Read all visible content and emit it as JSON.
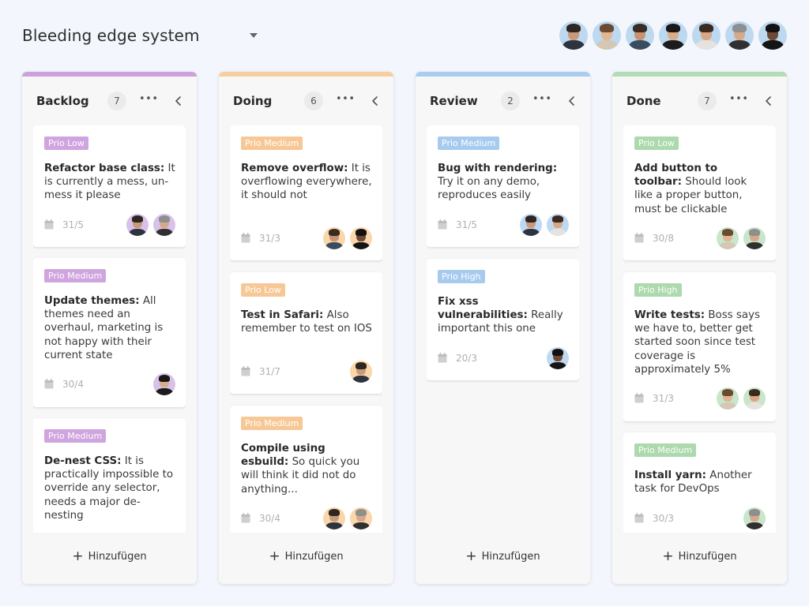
{
  "board": {
    "title": "Bleeding edge system",
    "members": [
      {
        "name": "member-1",
        "bg": "#bcd9f0",
        "skin": "#c99a7a",
        "hair": "#2f2622",
        "shirt": "#2d3440"
      },
      {
        "name": "member-2",
        "bg": "#bcd9f0",
        "skin": "#e3b592",
        "hair": "#6b4a31",
        "shirt": "#d4c7b5"
      },
      {
        "name": "member-3",
        "bg": "#bcd9f0",
        "skin": "#c79372",
        "hair": "#3a2c22",
        "shirt": "#3a4d5e"
      },
      {
        "name": "member-4",
        "bg": "#bcd9f0",
        "skin": "#d8ad8c",
        "hair": "#1c1717",
        "shirt": "#1c1c1c"
      },
      {
        "name": "member-5",
        "bg": "#bcd9f0",
        "skin": "#d9a786",
        "hair": "#3b2a20",
        "shirt": "#e7e2dd"
      },
      {
        "name": "member-6",
        "bg": "#bcd9f0",
        "skin": "#d6a98d",
        "hair": "#8f8f8f",
        "shirt": "#303030"
      },
      {
        "name": "member-7",
        "bg": "#bcd9f0",
        "skin": "#6e4a36",
        "hair": "#151111",
        "shirt": "#141414"
      }
    ]
  },
  "priority_colors": {
    "Prio Low": "#d2a6df",
    "Prio Medium": "#cba6e0",
    "Prio High": "#f5c99a"
  },
  "add_label": "Hinzufügen",
  "columns": [
    {
      "title": "Backlog",
      "count": "7",
      "color": "#cda2dc",
      "cards": [
        {
          "prio": "Prio Low",
          "badge_color": "#d0a4e0",
          "title": "Refactor base class:",
          "text": "It is currently a mess, un-mess it please",
          "due": "31/5",
          "assignees": [
            {
              "bg": "#d9c2ea",
              "skin": "#c99a7a",
              "hair": "#2f2622",
              "shirt": "#2d3440"
            },
            {
              "bg": "#d9c2ea",
              "skin": "#d6a98d",
              "hair": "#8f8f8f",
              "shirt": "#303030"
            }
          ]
        },
        {
          "prio": "Prio Medium",
          "badge_color": "#cfa4df",
          "title": "Update themes:",
          "text": "All themes need an overhaul, marketing is not happy with their current state",
          "due": "30/4",
          "assignees": [
            {
              "bg": "#d9c2ea",
              "skin": "#d8ad8c",
              "hair": "#1c1717",
              "shirt": "#1c1c1c"
            }
          ]
        },
        {
          "prio": "Prio Medium",
          "badge_color": "#cfa4df",
          "title": "De-nest CSS:",
          "text": "It is practically impossible to override any selector, needs a major de-nesting",
          "due": "",
          "assignees": []
        }
      ]
    },
    {
      "title": "Doing",
      "count": "6",
      "color": "#f7cf9e",
      "cards": [
        {
          "prio": "Prio Medium",
          "badge_color": "#f7c895",
          "title": "Remove overflow:",
          "text": "It is overflowing everywhere, it should not",
          "due": "31/3",
          "assignees": [
            {
              "bg": "#f9d7aa",
              "skin": "#c79372",
              "hair": "#3a2c22",
              "shirt": "#3a4d5e"
            },
            {
              "bg": "#f9d7aa",
              "skin": "#6e4a36",
              "hair": "#151111",
              "shirt": "#141414"
            }
          ]
        },
        {
          "prio": "Prio Low",
          "badge_color": "#f7c895",
          "title": "Test in Safari:",
          "text": "Also remember to test on IOS",
          "due": "31/7",
          "assignees": [
            {
              "bg": "#f9d7aa",
              "skin": "#c99a7a",
              "hair": "#2f2622",
              "shirt": "#2d3440"
            }
          ]
        },
        {
          "prio": "Prio Medium",
          "badge_color": "#f7c895",
          "title": "Compile using esbuild:",
          "text": "So quick you will think it did not do anything...",
          "due": "30/4",
          "assignees": [
            {
              "bg": "#f9d7aa",
              "skin": "#c99a7a",
              "hair": "#2f2622",
              "shirt": "#2d3440"
            },
            {
              "bg": "#f9d7aa",
              "skin": "#d6a98d",
              "hair": "#8f8f8f",
              "shirt": "#303030"
            }
          ]
        }
      ]
    },
    {
      "title": "Review",
      "count": "2",
      "color": "#a9cdf0",
      "cards": [
        {
          "prio": "Prio Medium",
          "badge_color": "#a6cbef",
          "title": "Bug with rendering:",
          "text": "Try it on any demo, reproduces easily",
          "due": "31/5",
          "assignees": [
            {
              "bg": "#bfd9f3",
              "skin": "#c99a7a",
              "hair": "#2f2622",
              "shirt": "#2d3440"
            },
            {
              "bg": "#bfd9f3",
              "skin": "#d9a786",
              "hair": "#3b2a20",
              "shirt": "#e7e2dd"
            }
          ]
        },
        {
          "prio": "Prio High",
          "badge_color": "#a6cbef",
          "title": "Fix xss vulnerabilities:",
          "text": "Really important this one",
          "due": "20/3",
          "assignees": [
            {
              "bg": "#bfd9f3",
              "skin": "#6e4a36",
              "hair": "#151111",
              "shirt": "#141414"
            }
          ]
        }
      ]
    },
    {
      "title": "Done",
      "count": "7",
      "color": "#b3dbb4",
      "cards": [
        {
          "prio": "Prio Low",
          "badge_color": "#acd9ad",
          "title": "Add button to toolbar:",
          "text": "Should look like a proper button, must be clickable",
          "due": "30/8",
          "assignees": [
            {
              "bg": "#c8e6c9",
              "skin": "#e3b592",
              "hair": "#6b4a31",
              "shirt": "#d4c7b5"
            },
            {
              "bg": "#c8e6c9",
              "skin": "#d6a98d",
              "hair": "#8f8f8f",
              "shirt": "#303030"
            }
          ]
        },
        {
          "prio": "Prio High",
          "badge_color": "#acd9ad",
          "title": "Write tests:",
          "text": "Boss says we have to, better get started soon since test coverage is approximately 5%",
          "due": "31/3",
          "assignees": [
            {
              "bg": "#c8e6c9",
              "skin": "#e3b592",
              "hair": "#6b4a31",
              "shirt": "#d4c7b5"
            },
            {
              "bg": "#c8e6c9",
              "skin": "#d9a786",
              "hair": "#3b2a20",
              "shirt": "#e7e2dd"
            }
          ]
        },
        {
          "prio": "Prio Medium",
          "badge_color": "#acd9ad",
          "title": "Install yarn:",
          "text": "Another task for DevOps",
          "due": "30/3",
          "assignees": [
            {
              "bg": "#c8e6c9",
              "skin": "#d6a98d",
              "hair": "#8f8f8f",
              "shirt": "#303030"
            }
          ]
        }
      ]
    }
  ]
}
